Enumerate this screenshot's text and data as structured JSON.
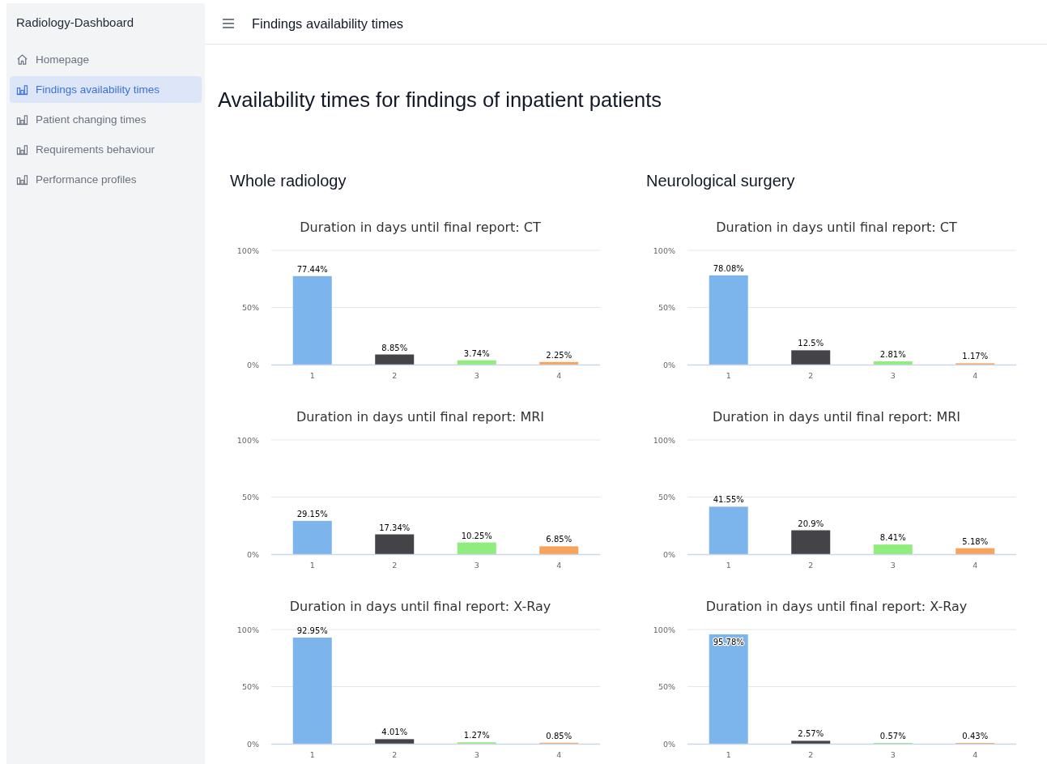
{
  "sidebar": {
    "title": "Radiology-Dashboard",
    "items": [
      {
        "label": "Homepage",
        "kind": "home",
        "selected": false
      },
      {
        "label": "Findings availability times",
        "kind": "chart",
        "selected": true
      },
      {
        "label": "Patient changing times",
        "kind": "chart",
        "selected": false
      },
      {
        "label": "Requirements behaviour",
        "kind": "chart",
        "selected": false
      },
      {
        "label": "Performance profiles",
        "kind": "chart",
        "selected": false
      }
    ]
  },
  "header": {
    "title": "Findings availability times"
  },
  "page_title": "Availability times for findings of inpatient patients",
  "sections": [
    {
      "title": "Whole radiology",
      "charts": [
        {
          "chart_data": {
            "type": "bar",
            "title": "Duration in days until final report: CT",
            "categories": [
              "1",
              "2",
              "3",
              "4"
            ],
            "series": [
              {
                "color": "#7cb5ec",
                "values": [
                  77.44,
                  null,
                  null,
                  null
                ]
              },
              {
                "color": "#434348",
                "values": [
                  null,
                  8.85,
                  null,
                  null
                ]
              },
              {
                "color": "#90ed7d",
                "values": [
                  null,
                  null,
                  3.74,
                  null
                ]
              },
              {
                "color": "#f7a35c",
                "values": [
                  null,
                  null,
                  null,
                  2.25
                ]
              }
            ],
            "ylim": [
              0,
              100
            ],
            "yticks": [
              {
                "value": 0,
                "label": "0%"
              },
              {
                "value": 50,
                "label": "50%"
              },
              {
                "value": 100,
                "label": "100%"
              }
            ],
            "value_labels": [
              "77.44%",
              "8.85%",
              "3.74%",
              "2.25%"
            ]
          }
        },
        {
          "chart_data": {
            "type": "bar",
            "title": "Duration in days until final report: MRI",
            "categories": [
              "1",
              "2",
              "3",
              "4"
            ],
            "series": [
              {
                "color": "#7cb5ec",
                "values": [
                  29.15,
                  null,
                  null,
                  null
                ]
              },
              {
                "color": "#434348",
                "values": [
                  null,
                  17.34,
                  null,
                  null
                ]
              },
              {
                "color": "#90ed7d",
                "values": [
                  null,
                  null,
                  10.25,
                  null
                ]
              },
              {
                "color": "#f7a35c",
                "values": [
                  null,
                  null,
                  null,
                  6.85
                ]
              }
            ],
            "ylim": [
              0,
              100
            ],
            "yticks": [
              {
                "value": 0,
                "label": "0%"
              },
              {
                "value": 50,
                "label": "50%"
              },
              {
                "value": 100,
                "label": "100%"
              }
            ],
            "value_labels": [
              "29.15%",
              "17.34%",
              "10.25%",
              "6.85%"
            ]
          }
        },
        {
          "chart_data": {
            "type": "bar",
            "title": "Duration in days until final report: X-Ray",
            "categories": [
              "1",
              "2",
              "3",
              "4"
            ],
            "series": [
              {
                "color": "#7cb5ec",
                "values": [
                  92.95,
                  null,
                  null,
                  null
                ]
              },
              {
                "color": "#434348",
                "values": [
                  null,
                  4.01,
                  null,
                  null
                ]
              },
              {
                "color": "#90ed7d",
                "values": [
                  null,
                  null,
                  1.27,
                  null
                ]
              },
              {
                "color": "#f7a35c",
                "values": [
                  null,
                  null,
                  null,
                  0.85
                ]
              }
            ],
            "ylim": [
              0,
              100
            ],
            "yticks": [
              {
                "value": 0,
                "label": "0%"
              },
              {
                "value": 50,
                "label": "50%"
              },
              {
                "value": 100,
                "label": "100%"
              }
            ],
            "value_labels": [
              "92.95%",
              "4.01%",
              "1.27%",
              "0.85%"
            ]
          }
        }
      ]
    },
    {
      "title": "Neurological surgery",
      "charts": [
        {
          "chart_data": {
            "type": "bar",
            "title": "Duration in days until final report: CT",
            "categories": [
              "1",
              "2",
              "3",
              "4"
            ],
            "series": [
              {
                "color": "#7cb5ec",
                "values": [
                  78.08,
                  null,
                  null,
                  null
                ]
              },
              {
                "color": "#434348",
                "values": [
                  null,
                  12.5,
                  null,
                  null
                ]
              },
              {
                "color": "#90ed7d",
                "values": [
                  null,
                  null,
                  2.81,
                  null
                ]
              },
              {
                "color": "#f7a35c",
                "values": [
                  null,
                  null,
                  null,
                  1.17
                ]
              }
            ],
            "ylim": [
              0,
              100
            ],
            "yticks": [
              {
                "value": 0,
                "label": "0%"
              },
              {
                "value": 50,
                "label": "50%"
              },
              {
                "value": 100,
                "label": "100%"
              }
            ],
            "value_labels": [
              "78.08%",
              "12.5%",
              "2.81%",
              "1.17%"
            ]
          }
        },
        {
          "chart_data": {
            "type": "bar",
            "title": "Duration in days until final report: MRI",
            "categories": [
              "1",
              "2",
              "3",
              "4"
            ],
            "series": [
              {
                "color": "#7cb5ec",
                "values": [
                  41.55,
                  null,
                  null,
                  null
                ]
              },
              {
                "color": "#434348",
                "values": [
                  null,
                  20.9,
                  null,
                  null
                ]
              },
              {
                "color": "#90ed7d",
                "values": [
                  null,
                  null,
                  8.41,
                  null
                ]
              },
              {
                "color": "#f7a35c",
                "values": [
                  null,
                  null,
                  null,
                  5.18
                ]
              }
            ],
            "ylim": [
              0,
              100
            ],
            "yticks": [
              {
                "value": 0,
                "label": "0%"
              },
              {
                "value": 50,
                "label": "50%"
              },
              {
                "value": 100,
                "label": "100%"
              }
            ],
            "value_labels": [
              "41.55%",
              "20.9%",
              "8.41%",
              "5.18%"
            ]
          }
        },
        {
          "chart_data": {
            "type": "bar",
            "title": "Duration in days until final report: X-Ray",
            "categories": [
              "1",
              "2",
              "3",
              "4"
            ],
            "series": [
              {
                "color": "#7cb5ec",
                "values": [
                  95.78,
                  null,
                  null,
                  null
                ]
              },
              {
                "color": "#434348",
                "values": [
                  null,
                  2.57,
                  null,
                  null
                ]
              },
              {
                "color": "#90ed7d",
                "values": [
                  null,
                  null,
                  0.57,
                  null
                ]
              },
              {
                "color": "#f7a35c",
                "values": [
                  null,
                  null,
                  null,
                  0.43
                ]
              }
            ],
            "ylim": [
              0,
              100
            ],
            "yticks": [
              {
                "value": 0,
                "label": "0%"
              },
              {
                "value": 50,
                "label": "50%"
              },
              {
                "value": 100,
                "label": "100%"
              }
            ],
            "value_labels": [
              "95.78%",
              "2.57%",
              "0.57%",
              "0.43%"
            ]
          }
        }
      ]
    }
  ]
}
